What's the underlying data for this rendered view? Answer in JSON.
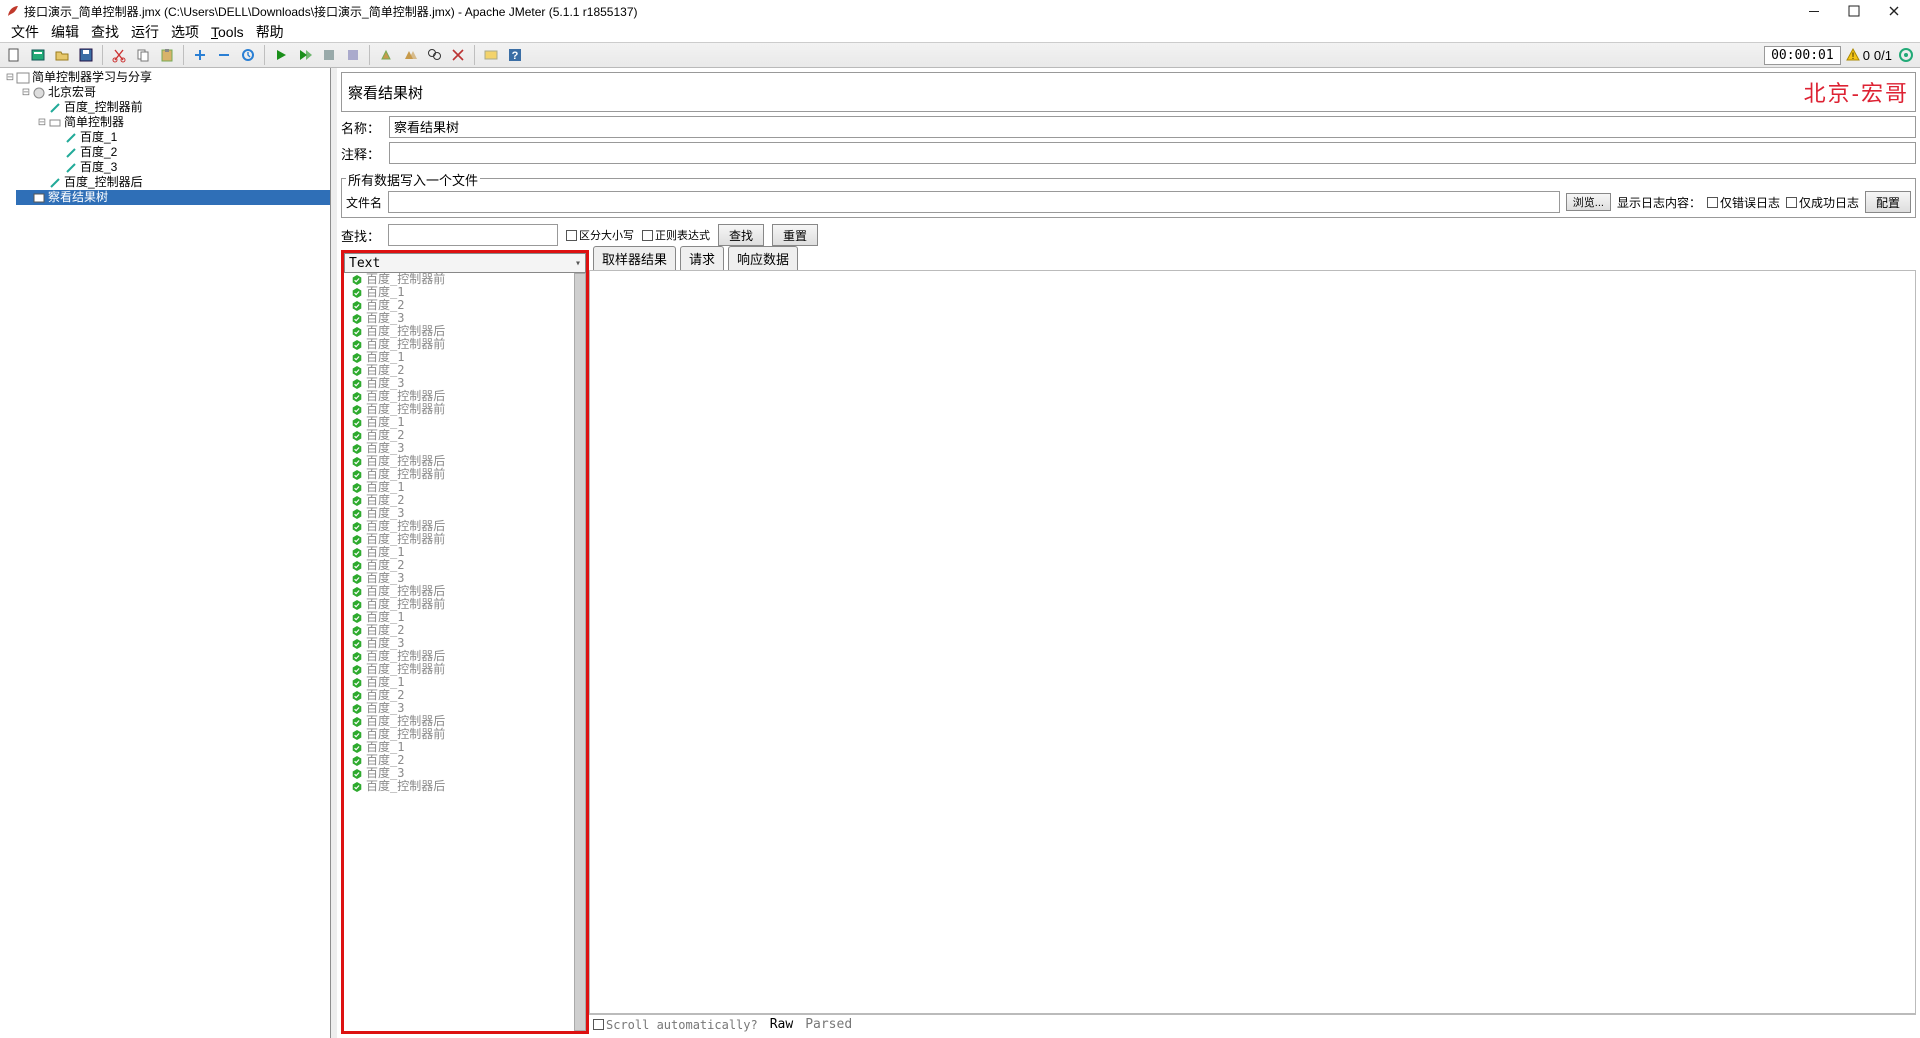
{
  "window": {
    "title": "接口演示_简单控制器.jmx (C:\\Users\\DELL\\Downloads\\接口演示_简单控制器.jmx) - Apache JMeter (5.1.1 r1855137)"
  },
  "menu": {
    "file": "文件",
    "edit": "编辑",
    "find": "查找",
    "run": "运行",
    "options": "选项",
    "tools_prefix": "T",
    "tools_rest": "ools",
    "help": "帮助"
  },
  "timer": "00:00:01",
  "warn_count": "0",
  "thread_text": "0/1",
  "tree": {
    "root": "简单控制器学习与分享",
    "tg": "北京宏哥",
    "pre": "百度_控制器前",
    "sc": "简单控制器",
    "c1": "百度_1",
    "c2": "百度_2",
    "c3": "百度_3",
    "post": "百度_控制器后",
    "vrt": "察看结果树"
  },
  "panel": {
    "title": "察看结果树",
    "watermark": "北京-宏哥",
    "name_label": "名称：",
    "name_value": "察看结果树",
    "comment_label": "注释：",
    "legend_file": "所有数据写入一个文件",
    "file_label": "文件名",
    "browse": "浏览...",
    "showlog_label": "显示日志内容：",
    "cb_err": "仅错误日志",
    "cb_ok": "仅成功日志",
    "configure": "配置"
  },
  "search": {
    "label": "查找：",
    "cb_case": "区分大小写",
    "cb_regex": "正则表达式",
    "btn_find": "查找",
    "btn_reset": "重置"
  },
  "results": {
    "combo": "Text",
    "scroll_label": "Scroll automatically?",
    "raw": "Raw",
    "parsed": "Parsed"
  },
  "tabs": {
    "sampler": "取样器结果",
    "request": "请求",
    "response": "响应数据"
  },
  "rcycle": [
    "百度_控制器前",
    "百度_1",
    "百度_2",
    "百度_3",
    "百度_控制器后"
  ]
}
